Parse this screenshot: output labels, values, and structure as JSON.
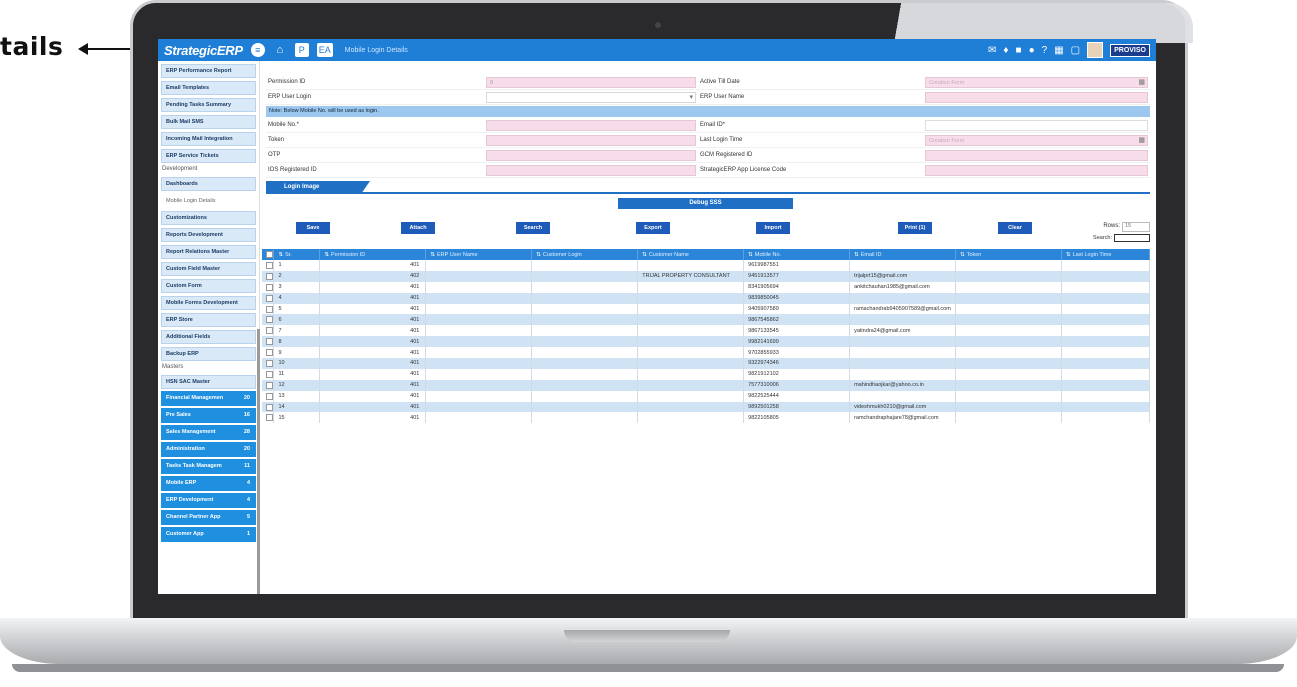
{
  "callout": {
    "text": "tails"
  },
  "header": {
    "logo": "StrategicERP",
    "title": "Mobile Login Details",
    "icons_left": [
      "menu-icon",
      "home-icon",
      "p-badge",
      "ea-badge"
    ],
    "p_label": "P",
    "ea_label": "EA",
    "icons_right": [
      "mail-icon",
      "mic-icon",
      "video-icon",
      "globe-icon",
      "help-icon",
      "calculator-icon",
      "window-icon"
    ],
    "brand": "PROVISO"
  },
  "sidebar": {
    "items": [
      {
        "label": "ERP Performance Report",
        "style": "item"
      },
      {
        "label": "Email Templates",
        "style": "item"
      },
      {
        "label": "Pending Tasks Summary",
        "style": "item"
      },
      {
        "label": "Bulk Mail SMS",
        "style": "item"
      },
      {
        "label": "Incoming Mail Integration",
        "style": "item"
      },
      {
        "label": "ERP Service Tickets",
        "style": "item"
      },
      {
        "label": "Development",
        "style": "section"
      },
      {
        "label": "Dashboards",
        "style": "item"
      },
      {
        "label": "Mobile Login Details",
        "style": "plain"
      },
      {
        "label": "Customizations",
        "style": "item"
      },
      {
        "label": "Reports Development",
        "style": "item"
      },
      {
        "label": "Report Relations Master",
        "style": "item"
      },
      {
        "label": "Custom Field Master",
        "style": "item"
      },
      {
        "label": "Custom Form",
        "style": "item"
      },
      {
        "label": "Mobile Forms Development",
        "style": "item"
      },
      {
        "label": "ERP Store",
        "style": "item"
      },
      {
        "label": "Additional Fields",
        "style": "item"
      },
      {
        "label": "Backup ERP",
        "style": "item"
      },
      {
        "label": "Masters",
        "style": "section"
      },
      {
        "label": "HSN SAC Master",
        "style": "item"
      }
    ],
    "modules": [
      {
        "label": "Financial Managemen",
        "count": "20"
      },
      {
        "label": "Pre Sales",
        "count": "16"
      },
      {
        "label": "Sales Management",
        "count": "28"
      },
      {
        "label": "Administration",
        "count": "20"
      },
      {
        "label": "Tasks Task Managem",
        "count": "11"
      },
      {
        "label": "Mobile ERP",
        "count": "4"
      },
      {
        "label": "ERP Development",
        "count": "4"
      },
      {
        "label": "Channel Partner App",
        "count": "5"
      },
      {
        "label": "Customer App",
        "count": "1"
      }
    ]
  },
  "form": {
    "permission_id_label": "Permission ID",
    "permission_id_value": "0",
    "active_till_label": "Active Till Date",
    "active_till_placeholder": "Creation Form",
    "erp_user_login_label": "ERP User Login",
    "erp_user_name_label": "ERP User Name",
    "note": "Note: Below Mobile No. will be used as login.",
    "mobile_label": "Mobile No.*",
    "email_label": "Email ID*",
    "token_label": "Token",
    "last_login_label": "Last Login Time",
    "last_login_placeholder": "Creation Form",
    "otp_label": "OTP",
    "gcm_label": "GCM Registered ID",
    "ios_label": "IOS Registered ID",
    "license_label": "StrategicERP App License Code",
    "tab_label": "Login Image",
    "debug_label": "Debug SSS"
  },
  "toolbar": {
    "buttons": [
      "Save",
      "Attach",
      "Search",
      "Export",
      "Import",
      "Print (1)",
      "Clear"
    ],
    "rows_label": "Rows:",
    "rows_value": "15",
    "search_label": "Search:"
  },
  "table": {
    "columns": [
      "Sr.",
      "Permission ID",
      "ERP User Name",
      "Customer Login",
      "Customer Name",
      "Mobile No.",
      "Email ID",
      "Token",
      "Last Login Time"
    ],
    "rows": [
      [
        "1",
        "401",
        "",
        "",
        "",
        "9619987551",
        "",
        "",
        ""
      ],
      [
        "2",
        "402",
        "",
        "",
        "TRIJAL PROPERTY CONSULTANT",
        "9451913577",
        "trijalprt15@gmail.com",
        "",
        ""
      ],
      [
        "3",
        "401",
        "",
        "",
        "",
        "8341905694",
        "ankitchauhan1985@gmail.com",
        "",
        ""
      ],
      [
        "4",
        "401",
        "",
        "",
        "",
        "9839850045",
        "",
        "",
        ""
      ],
      [
        "5",
        "401",
        "",
        "",
        "",
        "9405907589",
        "ramachandrab9405907589@gmail.com",
        "",
        ""
      ],
      [
        "6",
        "401",
        "",
        "",
        "",
        "9867545862",
        "",
        "",
        ""
      ],
      [
        "7",
        "401",
        "",
        "",
        "",
        "9867133545",
        "yatindra24@gmail.com",
        "",
        ""
      ],
      [
        "8",
        "401",
        "",
        "",
        "",
        "9982141699",
        "",
        "",
        ""
      ],
      [
        "9",
        "401",
        "",
        "",
        "",
        "9702855933",
        "",
        "",
        ""
      ],
      [
        "10",
        "401",
        "",
        "",
        "",
        "9322974346",
        "",
        "",
        ""
      ],
      [
        "11",
        "401",
        "",
        "",
        "",
        "9821912102",
        "",
        "",
        ""
      ],
      [
        "12",
        "401",
        "",
        "",
        "",
        "7577310006",
        "mahindhaojkar@yahoo.co.in",
        "",
        ""
      ],
      [
        "13",
        "401",
        "",
        "",
        "",
        "9822525444",
        "",
        "",
        ""
      ],
      [
        "14",
        "401",
        "",
        "",
        "",
        "9892501258",
        "videshmukh0210@gmail.com",
        "",
        ""
      ],
      [
        "15",
        "401",
        "",
        "",
        "",
        "9822105805",
        "ramchandraphajare78@gmail.com",
        "",
        ""
      ]
    ]
  }
}
